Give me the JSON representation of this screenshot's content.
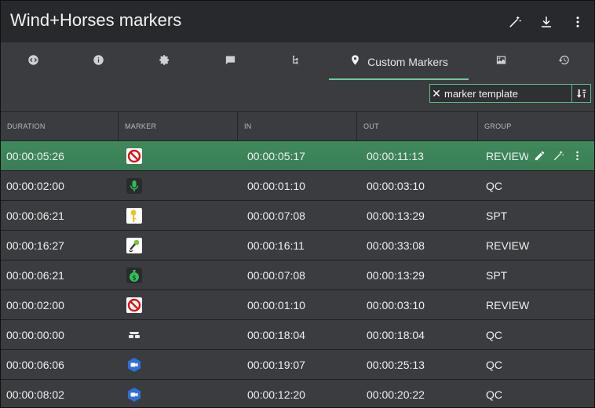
{
  "window": {
    "title": "Wind+Horses markers"
  },
  "header_actions": [
    {
      "icon": "magic-wand-icon"
    },
    {
      "icon": "download-icon"
    },
    {
      "icon": "more-vert-icon"
    }
  ],
  "tabs": [
    {
      "icon": "code-icon",
      "label": ""
    },
    {
      "icon": "info-icon",
      "label": ""
    },
    {
      "icon": "settings-icon",
      "label": ""
    },
    {
      "icon": "comment-icon",
      "label": ""
    },
    {
      "icon": "hierarchy-icon",
      "label": ""
    },
    {
      "icon": "location-pin-icon",
      "label": "Custom Markers",
      "active": true
    },
    {
      "icon": "image-icon",
      "label": ""
    },
    {
      "icon": "history-icon",
      "label": ""
    }
  ],
  "filter": {
    "value": "marker template",
    "clear_symbol": "✕"
  },
  "table": {
    "headers": [
      "DURATION",
      "MARKER",
      "IN",
      "OUT",
      "GROUP"
    ],
    "rows": [
      {
        "duration": "00:00:05:26",
        "marker": "no-entry-icon",
        "in": "00:00:05:17",
        "out": "00:00:11:13",
        "group": "REVIEW",
        "selected": true
      },
      {
        "duration": "00:00:02:00",
        "marker": "microphone-icon",
        "in": "00:00:01:10",
        "out": "00:00:03:10",
        "group": "QC"
      },
      {
        "duration": "00:00:06:21",
        "marker": "key-icon",
        "in": "00:00:07:08",
        "out": "00:00:13:29",
        "group": "SPT"
      },
      {
        "duration": "00:00:16:27",
        "marker": "hand-microphone-icon",
        "in": "00:00:16:11",
        "out": "00:00:33:08",
        "group": "REVIEW"
      },
      {
        "duration": "00:00:06:21",
        "marker": "money-bag-icon",
        "in": "00:00:07:08",
        "out": "00:00:13:29",
        "group": "SPT"
      },
      {
        "duration": "00:00:02:00",
        "marker": "no-entry-icon",
        "in": "00:00:01:10",
        "out": "00:00:03:10",
        "group": "REVIEW"
      },
      {
        "duration": "00:00:00:00",
        "marker": "spy-glasses-icon",
        "in": "00:00:18:04",
        "out": "00:00:18:04",
        "group": "QC"
      },
      {
        "duration": "00:00:06:06",
        "marker": "video-camera-icon",
        "in": "00:00:19:07",
        "out": "00:00:25:13",
        "group": "QC"
      },
      {
        "duration": "00:00:08:02",
        "marker": "video-camera-icon",
        "in": "00:00:12:20",
        "out": "00:00:20:22",
        "group": "QC"
      }
    ]
  },
  "row_actions": [
    {
      "icon": "edit-pencil-icon"
    },
    {
      "icon": "magic-wand-icon"
    },
    {
      "icon": "more-vert-icon"
    }
  ],
  "colors": {
    "accent": "#6ec99a",
    "selected_row": "#3c8459",
    "background": "#3b3c40",
    "titlebar": "#28292c"
  }
}
